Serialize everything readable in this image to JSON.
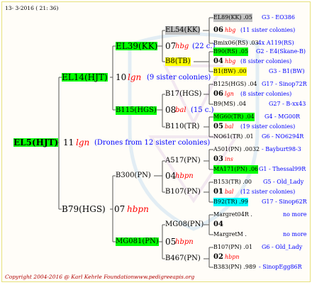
{
  "header": {
    "date": "13- 3-2016 ( 21: 36)"
  },
  "footer": {
    "copyright": "Copyright 2004-2016 @ Karl Kehrle Foundation.",
    "site": "www.pedigreeapis.org"
  },
  "colors": {
    "green": "#00ff00",
    "yellow": "#ffff00",
    "cyan": "#00ffff",
    "silver": "#c0c0c0",
    "red": "#ff0000",
    "blue": "#0000ff"
  },
  "gen1": {
    "name": "EL5(HJT)",
    "num": "11",
    "tag": "lgn",
    "note": "(Drones from 12 sister colonies)"
  },
  "gen2": {
    "top": {
      "name": "EL14(HJT)",
      "num": "10",
      "tag": "lgn",
      "note": "(9 sister colonies)"
    },
    "bottom": {
      "name": "B79(HGS)",
      "num": "07",
      "tag": "hbpn"
    }
  },
  "gen3": {
    "a": {
      "name": "EL39(KK)",
      "num": "07",
      "tag": "hbg",
      "note": "(22 c.)"
    },
    "b": {
      "name": "B115(HGS)",
      "num": "08",
      "tag": "bal",
      "note": "(15 c.)"
    },
    "c": {
      "name": "B300(PN)",
      "num": "04",
      "tag": "hbpn"
    },
    "d": {
      "name": "MG081(PN)",
      "num": "05",
      "tag": "hbpn"
    }
  },
  "gen4": {
    "a1": "EL54(KK)",
    "a2": "B8(TB)",
    "b1": "B17(HGS)",
    "b2": "B110(TR)",
    "c1": "A517(PN)",
    "c2": "B107(PN)",
    "d1": "MG08(PN)",
    "d2": "B467(PN)"
  },
  "gen5": {
    "a1": {
      "top": "EL89(KK) .05",
      "topc": "G3 - EO386",
      "num": "06",
      "tag": "hbg",
      "note": "(11 sister colonies)",
      "bot": "Bmix06(RS) .03",
      "botc": "-4x A119(RS)"
    },
    "a2": {
      "top": "B90(RS) .05",
      "topc": "G2 - E4(Skane-B)",
      "num": "04",
      "tag": "hbg",
      "note": "(8 sister colonies)",
      "bot": "B1(BW) .00",
      "botc": "G3 - B1(BW)"
    },
    "b1": {
      "top": "B125(HGS) .04",
      "topc": "G17 - Sinop72R",
      "num": "06",
      "tag": "lgn",
      "note": "(8 sister colonies)",
      "bot": "B9(MS) .04",
      "botc": "G27 - B-xx43"
    },
    "b2": {
      "top": "MG60(TR) .04",
      "topc": "G4 - MG00R",
      "num": "05",
      "tag": "bal",
      "note": "(19 sister colonies)",
      "bot": "NO61(TR) .01",
      "botc": "G6 - NO6294R"
    },
    "c1": {
      "top": "A501(PN) .0032",
      "topc": "- Bayburt98-3",
      "num": "03",
      "tag": "ins",
      "note": "",
      "bot": "MA171(PN) .06",
      "botc": "G1 - Thessal99R"
    },
    "c2": {
      "top": "B153(TR) .00",
      "topc": "G5 - Old_Lady",
      "num": "01",
      "tag": "bal",
      "note": "(12 sister colonies)",
      "bot": "B92(TR) .99",
      "botc": "G17 - Sinop62R"
    },
    "d1": {
      "top": "Margret04R .",
      "topc": "no more",
      "num": "04",
      "tag": "",
      "note": "",
      "bot": "MargretM .",
      "botc": "no more"
    },
    "d2": {
      "top": "B107(PN) .01",
      "topc": "G6 - Old_Lady",
      "num": "02",
      "tag": "hbpn",
      "note": "",
      "bot": "B383(PN) .989",
      "botc": "- SinopEgg86R"
    }
  }
}
